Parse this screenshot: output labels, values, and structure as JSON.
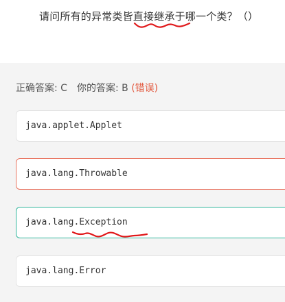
{
  "question": {
    "text": "请问所有的异常类皆直接继承于哪一个类？（）"
  },
  "result": {
    "correct_label": "正确答案: C",
    "your_label": "你的答案: B",
    "status": "(错误)"
  },
  "options": [
    {
      "text": "java.applet.Applet"
    },
    {
      "text": "java.lang.Throwable"
    },
    {
      "text": "java.lang.Exception"
    },
    {
      "text": "java.lang.Error"
    }
  ],
  "colors": {
    "wrong": "#e8735f",
    "correct": "#2fb59b",
    "annotation": "#e0181a"
  }
}
